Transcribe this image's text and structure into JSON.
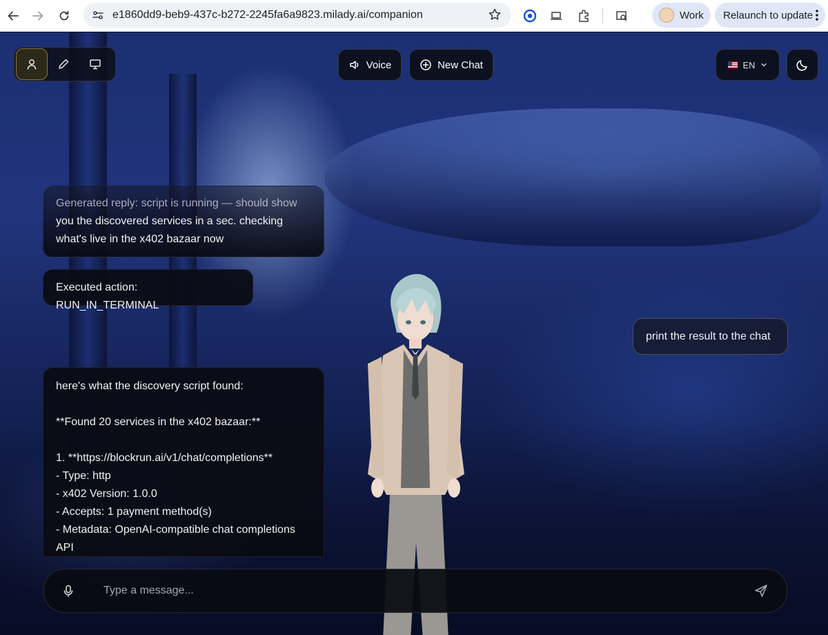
{
  "browser": {
    "url": "e1860dd9-beb9-437c-b272-2245fa6a9823.milady.ai/companion",
    "profile_label": "Work",
    "relaunch_label": "Relaunch to update"
  },
  "toolbar": {
    "voice_label": "Voice",
    "new_chat_label": "New Chat",
    "language_label": "EN"
  },
  "messages": {
    "generated_reply": [
      "Generated reply: script is running — should show",
      "you the discovered services in a sec. checking",
      "what's live in the x402 bazaar now"
    ],
    "executed_action": "Executed action: RUN_IN_TERMINAL",
    "user_message": "print the result to the chat",
    "result_lines": [
      "here's what the discovery script found:",
      "",
      "**Found 20 services in the x402 bazaar:**",
      "",
      "1. **https://blockrun.ai/v1/chat/completions**",
      "- Type: http",
      "- x402 Version: 1.0.0",
      "- Accepts: 1 payment method(s)",
      "- Metadata: OpenAI-compatible chat completions",
      "API"
    ]
  },
  "composer": {
    "placeholder": "Type a message..."
  }
}
